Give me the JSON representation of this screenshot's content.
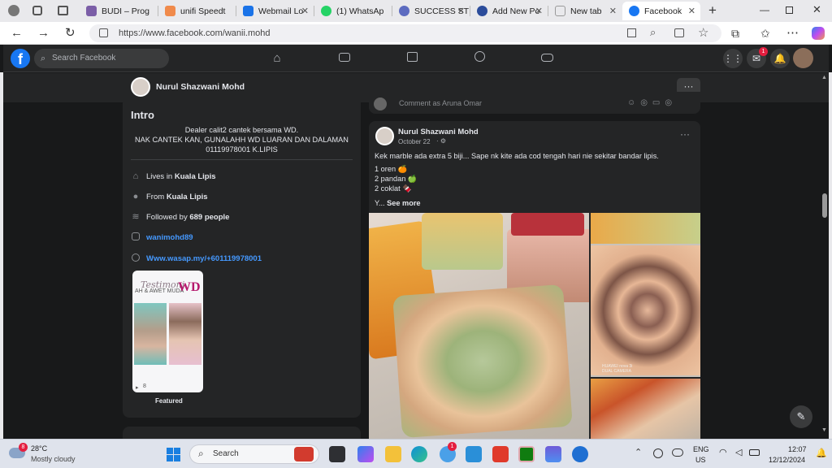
{
  "browser": {
    "tabs": [
      {
        "label": "BUDI – Prog",
        "color": "#7b5ea7"
      },
      {
        "label": "unifi Speedt",
        "color": "#f08a4b"
      },
      {
        "label": "Webmail Lo",
        "color": "#1a73e8"
      },
      {
        "label": "(1) WhatsAp",
        "color": "#25d366"
      },
      {
        "label": "SUCCESS ST",
        "color": "#5c6bc0"
      },
      {
        "label": "Add New Po",
        "color": "#2b4c9b"
      },
      {
        "label": "New tab",
        "color": "#999999"
      },
      {
        "label": "Facebook",
        "color": "#1877f2"
      }
    ],
    "url": "https://www.facebook.com/wanii.mohd"
  },
  "fb": {
    "search_placeholder": "Search Facebook",
    "notif_count": "1",
    "profile_name": "Nurul Shazwani Mohd"
  },
  "intro": {
    "title": "Intro",
    "bio_line1": "Dealer calit2 cantek bersama WD.",
    "bio_line2": "NAK CANTEK KAN, GUNALAHH WD LUARAN DAN DALAMAN",
    "bio_line3": "01119978001 K.LIPIS",
    "lives_prefix": "Lives in ",
    "lives_place": "Kuala Lipis",
    "from_prefix": "From ",
    "from_place": "Kuala Lipis",
    "followed_prefix": "Followed by ",
    "followed_count": "689 people",
    "instagram": "wanimohd89",
    "whatsapp": "Www.wasap.my/+601119978001",
    "featured_label": "Featured",
    "featured_views": "8",
    "featured_title": "Testimoni",
    "featured_sub": "AH & AWET MUDA",
    "featured_brand": "WD"
  },
  "prev_post": {
    "comment_placeholder": "Comment as Aruna Omar"
  },
  "post": {
    "author": "Nurul Shazwani Mohd",
    "date": "October 22",
    "privacy": "·",
    "line1": "Kek marble ada extra 5 biji... Sape nk kite ada cod tengah hari nie sekitar bandar lipis.",
    "line2": "1 oren 🍊",
    "line3": "2 pandan 🍏",
    "line4": "2 coklat 🍫",
    "see_more_prefix": "Y... ",
    "see_more": "See more",
    "photo_watermark": "HUAWEI nova 3i\nDUAL CAMERA"
  },
  "taskbar": {
    "weather_temp": "28°C",
    "weather_desc": "Mostly cloudy",
    "weather_badge": "8",
    "search": "Search",
    "lang1": "ENG",
    "lang2": "US",
    "time": "12:07",
    "date": "12/12/2024"
  }
}
